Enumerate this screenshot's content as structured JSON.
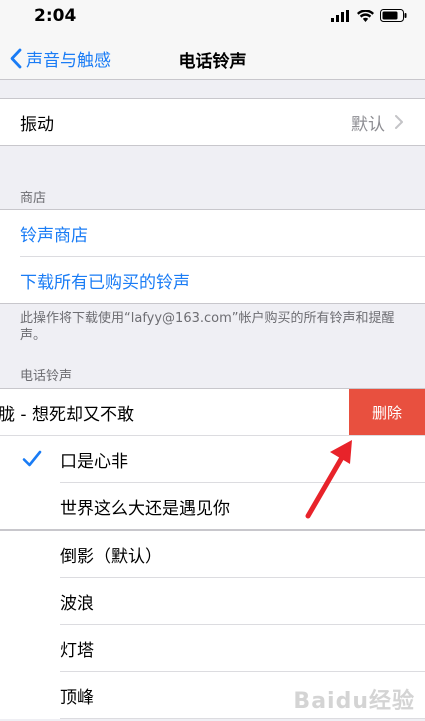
{
  "status": {
    "time": "2:04"
  },
  "nav": {
    "back_label": "声音与触感",
    "title": "电话铃声"
  },
  "vibration": {
    "label": "振动",
    "value": "默认"
  },
  "store_section": {
    "header": "商店",
    "items": [
      "铃声商店",
      "下载所有已购买的铃声"
    ],
    "footer": "此操作将下载使用“lafyy@163.com”帐户购买的所有铃声和提醒声。"
  },
  "ringtones_section": {
    "header": "电话铃声",
    "swiped_item": {
      "label": "胧 - 想死却又不敢",
      "delete_label": "删除"
    },
    "custom_items": [
      {
        "label": "口是心非",
        "selected": true
      },
      {
        "label": "世界这么大还是遇见你",
        "selected": false
      }
    ],
    "builtin_items": [
      "倒影（默认）",
      "波浪",
      "灯塔",
      "顶峰"
    ]
  },
  "colors": {
    "accent": "#1a7cf5",
    "delete": "#e8503f",
    "annotation_arrow": "#e8232a"
  },
  "watermark": {
    "text": "Baidu经验"
  }
}
